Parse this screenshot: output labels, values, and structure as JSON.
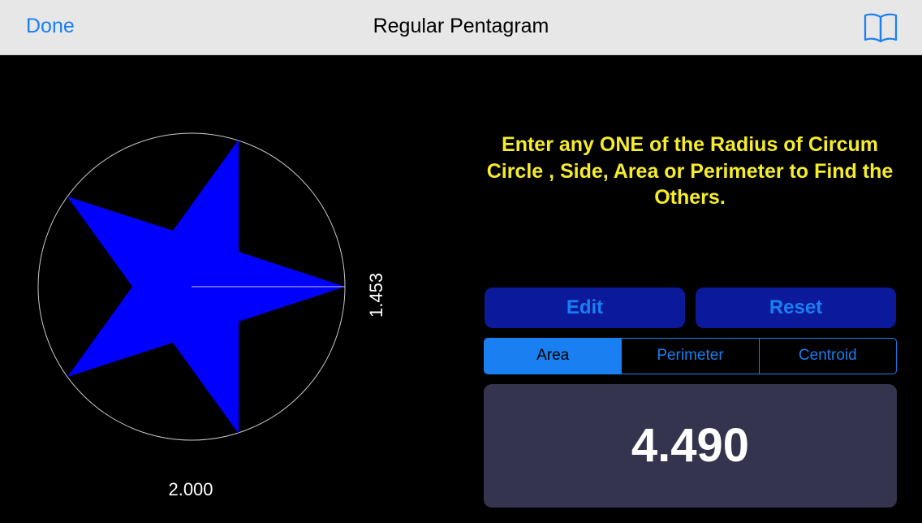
{
  "navbar": {
    "done_label": "Done",
    "title": "Regular Pentagram",
    "book_icon": "book-icon"
  },
  "figure": {
    "radius_value": "1.453",
    "side_value": "2.000",
    "star_color": "#0000ff",
    "circle_color": "#c8c8c8"
  },
  "instructions": "Enter any ONE of the Radius of Circum Circle , Side, Area or Perimeter to Find the Others.",
  "buttons": {
    "edit_label": "Edit",
    "reset_label": "Reset"
  },
  "segments": {
    "items": [
      "Area",
      "Perimeter",
      "Centroid"
    ],
    "selected": "Area"
  },
  "result": {
    "value": "4.490"
  },
  "colors": {
    "accent": "#1a7ff0",
    "instruction_text": "#f5ec2a",
    "button_bg": "#0a1a9a",
    "result_bg": "#34344e"
  }
}
